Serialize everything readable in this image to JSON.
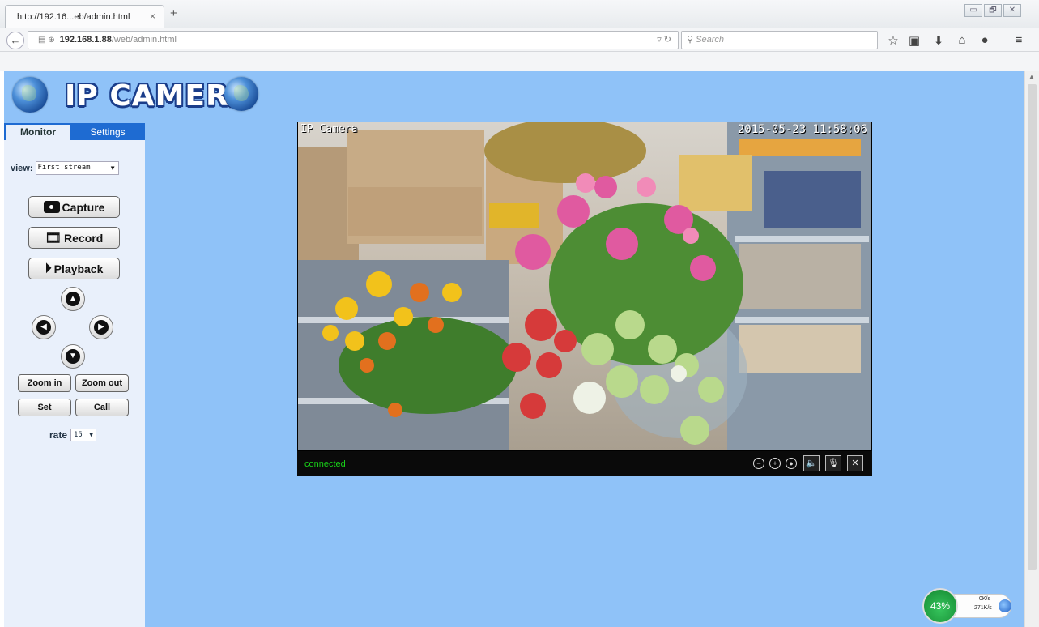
{
  "browser": {
    "tab_title": "http://192.16...eb/admin.html",
    "tab_close": "×",
    "new_tab": "+",
    "url_host": "192.168.1.88",
    "url_path": "/web/admin.html",
    "search_placeholder": "Search",
    "window_controls": [
      "▭",
      "🗗",
      "✕"
    ],
    "toolbar_icons": [
      "star-icon",
      "reading-list-icon",
      "download-icon",
      "home-icon",
      "chat-icon",
      "menu-icon"
    ]
  },
  "banner": {
    "title": "IP CAMERA"
  },
  "sidebar": {
    "tabs": {
      "monitor": "Monitor",
      "settings": "Settings"
    },
    "view_label": "view:",
    "view_value": "First stream",
    "buttons": {
      "capture": "Capture",
      "record": "Record",
      "playback": "Playback",
      "zoom_in": "Zoom in",
      "zoom_out": "Zoom out",
      "set": "Set",
      "call": "Call"
    },
    "rate_label": "rate",
    "rate_value": "15"
  },
  "video": {
    "osd_title": "IP Camera",
    "osd_timestamp": "2015-05-23 11:58:06",
    "status": "connected"
  },
  "net_monitor": {
    "percent": "43%",
    "up": "0K/s",
    "down": "271K/s"
  },
  "colors": {
    "page_bg": "#8fc2f8",
    "sidebar_tab_bar": "#1e6bd2",
    "status_connected": "#19d119"
  }
}
